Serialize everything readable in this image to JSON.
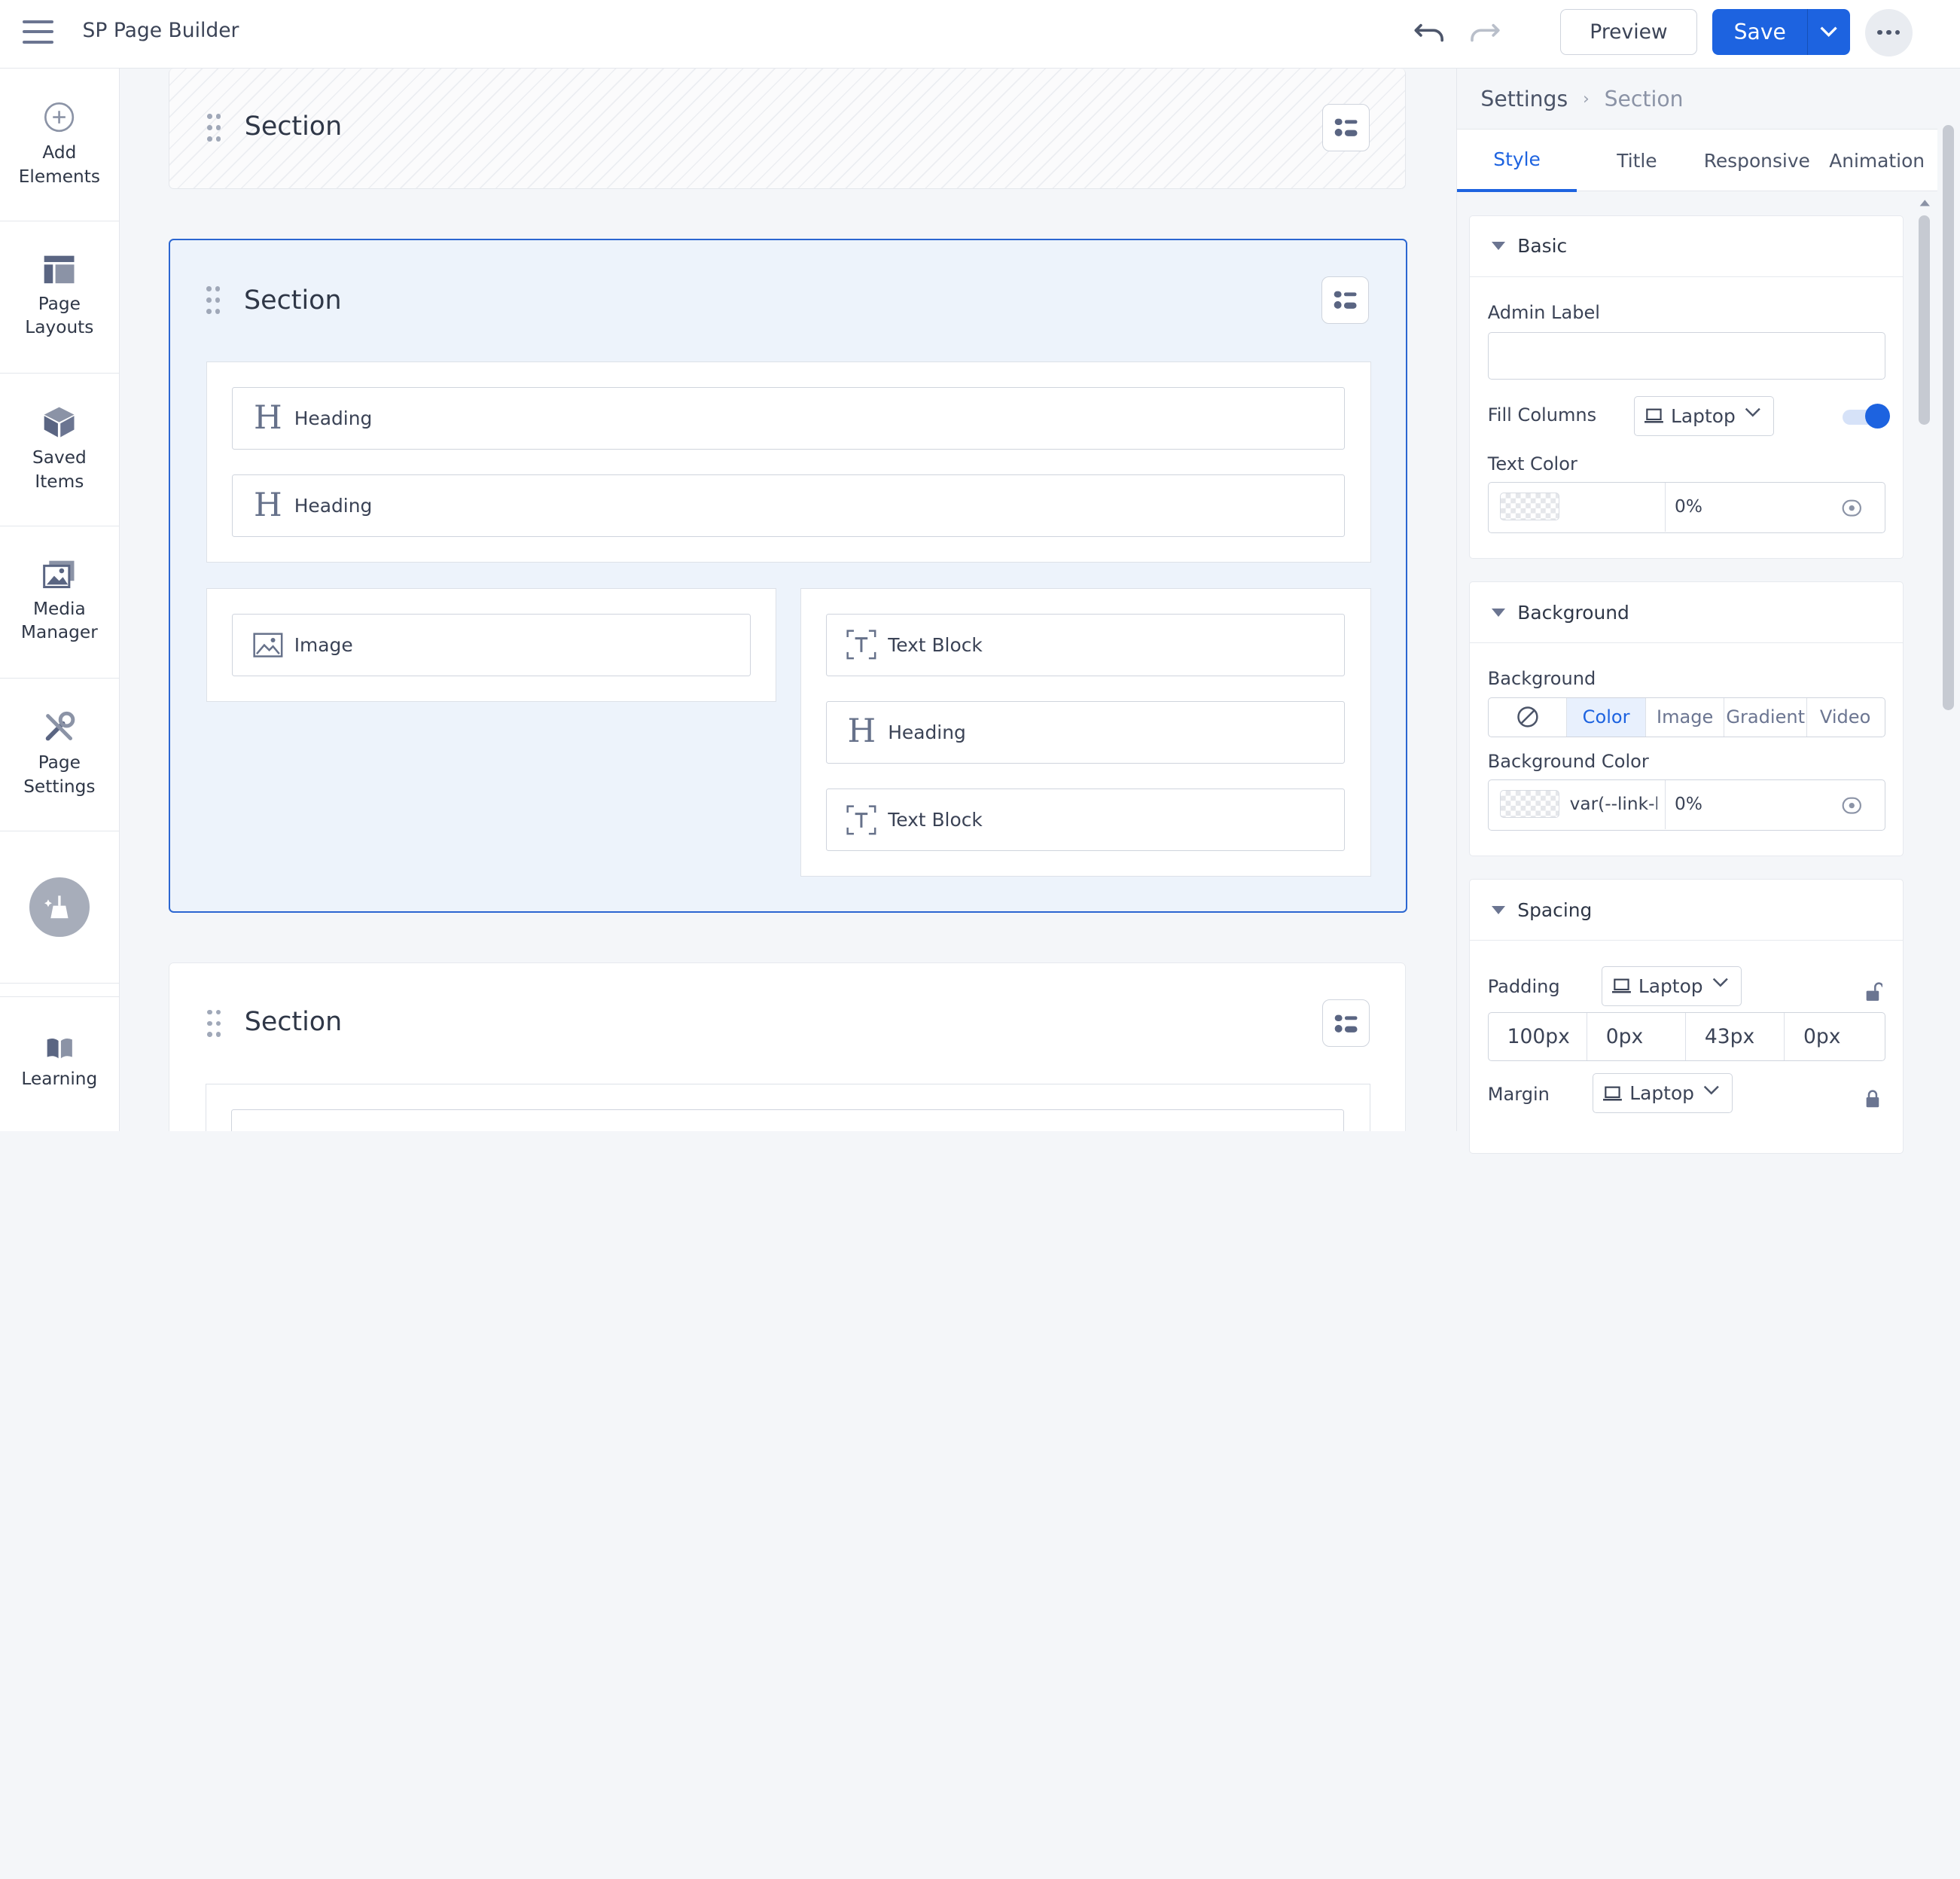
{
  "app": {
    "title": "SP Page Builder"
  },
  "toolbar": {
    "preview_label": "Preview",
    "save_label": "Save"
  },
  "sidebar": {
    "items": [
      {
        "label": "Add\nElements",
        "icon": "plus-circle-icon"
      },
      {
        "label": "Page\nLayouts",
        "icon": "layout-icon"
      },
      {
        "label": "Saved\nItems",
        "icon": "box-icon"
      },
      {
        "label": "Media\nManager",
        "icon": "media-icon"
      },
      {
        "label": "Page\nSettings",
        "icon": "tools-icon"
      },
      {
        "label": "Learning",
        "icon": "book-icon"
      }
    ]
  },
  "canvas": {
    "sections": [
      {
        "title": "Section"
      },
      {
        "title": "Section"
      },
      {
        "title": "Section"
      }
    ],
    "active_section": {
      "row1": [
        {
          "label": "Heading"
        },
        {
          "label": "Heading"
        }
      ],
      "col_left": [
        {
          "label": "Image"
        }
      ],
      "col_right": [
        {
          "label": "Text Block"
        },
        {
          "label": "Heading"
        },
        {
          "label": "Text Block"
        }
      ]
    }
  },
  "panel": {
    "breadcrumb": {
      "root": "Settings",
      "current": "Section"
    },
    "tabs": [
      "Style",
      "Title",
      "Responsive",
      "Animation"
    ],
    "active_tab": "Style",
    "basic": {
      "title": "Basic",
      "admin_label": "Admin Label",
      "admin_value": "",
      "fill_columns": "Fill Columns",
      "fill_device": "Laptop",
      "fill_enabled": true,
      "text_color_label": "Text Color",
      "text_color_opacity": "0%"
    },
    "background": {
      "title": "Background",
      "bg_label": "Background",
      "options": [
        "Color",
        "Image",
        "Gradient",
        "Video"
      ],
      "selected": "Color",
      "bg_color_label": "Background Color",
      "bg_color_value": "var(--link-b",
      "bg_color_opacity": "0%"
    },
    "spacing": {
      "title": "Spacing",
      "padding_label": "Padding",
      "padding_device": "Laptop",
      "padding": [
        "100px",
        "0px",
        "43px",
        "0px"
      ],
      "margin_label": "Margin",
      "margin_device": "Laptop"
    }
  },
  "colors": {
    "accent": "#1d63e0",
    "active_section_bg": "#edf3fb"
  }
}
